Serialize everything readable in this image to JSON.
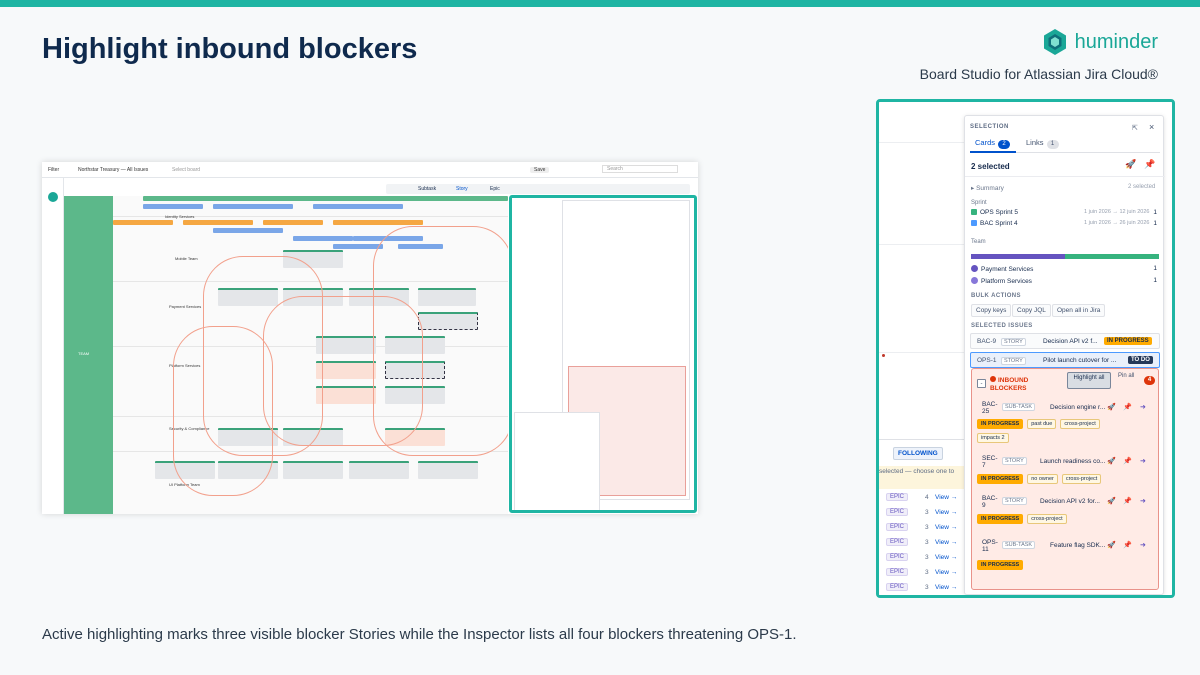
{
  "slide": {
    "title": "Highlight inbound blockers",
    "brand": "huminder",
    "subtitle": "Board Studio for Atlassian Jira Cloud®",
    "caption": "Active highlighting marks three visible blocker Stories while the Inspector lists all four blockers threatening OPS-1."
  },
  "colors": {
    "accent": "#1fb5a3",
    "title": "#0f2a4d",
    "in_progress": "#ffab00",
    "blocker": "#de350b",
    "team_lane": "#5cb88a"
  },
  "mini_screenshot": {
    "filter_label": "Filter",
    "board_name": "Northstar Treasury — All Issues",
    "select_board": "Select board",
    "save_label": "Save",
    "search_placeholder": "Search",
    "team_label": "TEAM",
    "lanes": [
      "Identity Services",
      "Mobile Team",
      "Payment Services",
      "Platform Services",
      "Security & Compliance",
      "UI Platform Team"
    ],
    "view_tabs": [
      "Subtask",
      "Story",
      "Epic"
    ]
  },
  "inspector": {
    "section_label": "SELECTION",
    "tabs": [
      {
        "label": "Cards",
        "count": "2"
      },
      {
        "label": "Links",
        "count": "1"
      }
    ],
    "selected_count": "2 selected",
    "summary_label": "▸ Summary",
    "summary_right": "2 selected",
    "sprint_label": "Sprint",
    "sprints": [
      {
        "name": "OPS Sprint 5",
        "dates": "1 juin 2026 → 12 juin 2026",
        "count": "1",
        "color": "#36b37e"
      },
      {
        "name": "BAC Sprint 4",
        "dates": "1 juin 2026 → 26 juin 2026",
        "count": "1",
        "color": "#4c9aff"
      }
    ],
    "team_label": "Team",
    "teams": [
      {
        "name": "Payment Services",
        "count": "1",
        "color": "#6554c0"
      },
      {
        "name": "Platform Services",
        "count": "1",
        "color": "#8777d9"
      }
    ],
    "bulk_label": "BULK ACTIONS",
    "bulk_actions": [
      "Copy keys",
      "Copy JQL",
      "Open all in Jira"
    ],
    "selected_issues_label": "SELECTED ISSUES",
    "selected_issues": [
      {
        "key": "BAC-9",
        "type": "STORY",
        "title": "Decision API v2 f...",
        "status": "IN PROGRESS"
      },
      {
        "key": "OPS-1",
        "type": "STORY",
        "title": "Pilot launch cutover for ...",
        "status": "TO DO"
      }
    ],
    "blockers": {
      "title": "INBOUND BLOCKERS",
      "highlight_label": "Highlight all",
      "pin_label": "Pin all",
      "count": "4",
      "items": [
        {
          "key": "BAC-25",
          "type": "SUB-TASK",
          "title": "Decision engine r...",
          "tags": [
            "IN PROGRESS",
            "past due",
            "cross-project",
            "impacts 2"
          ]
        },
        {
          "key": "SEC-7",
          "type": "STORY",
          "title": "Launch readiness co...",
          "tags": [
            "IN PROGRESS",
            "no owner",
            "cross-project"
          ]
        },
        {
          "key": "BAC-9",
          "type": "STORY",
          "title": "Decision API v2 for...",
          "tags": [
            "IN PROGRESS",
            "cross-project"
          ]
        },
        {
          "key": "OPS-11",
          "type": "SUB-TASK",
          "title": "Feature flag SDK...",
          "tags": [
            "IN PROGRESS"
          ]
        }
      ]
    }
  },
  "following_panel": {
    "button": "FOLLOWING",
    "hint": "selected — choose one to",
    "rows": [
      {
        "type": "EPIC",
        "num": "4",
        "view": "View →"
      },
      {
        "type": "EPIC",
        "num": "3",
        "view": "View →"
      },
      {
        "type": "EPIC",
        "num": "3",
        "view": "View →"
      },
      {
        "type": "EPIC",
        "num": "3",
        "view": "View →"
      },
      {
        "type": "EPIC",
        "num": "3",
        "view": "View →"
      },
      {
        "type": "EPIC",
        "num": "3",
        "view": "View →"
      },
      {
        "type": "EPIC",
        "num": "3",
        "view": "View →"
      }
    ]
  }
}
